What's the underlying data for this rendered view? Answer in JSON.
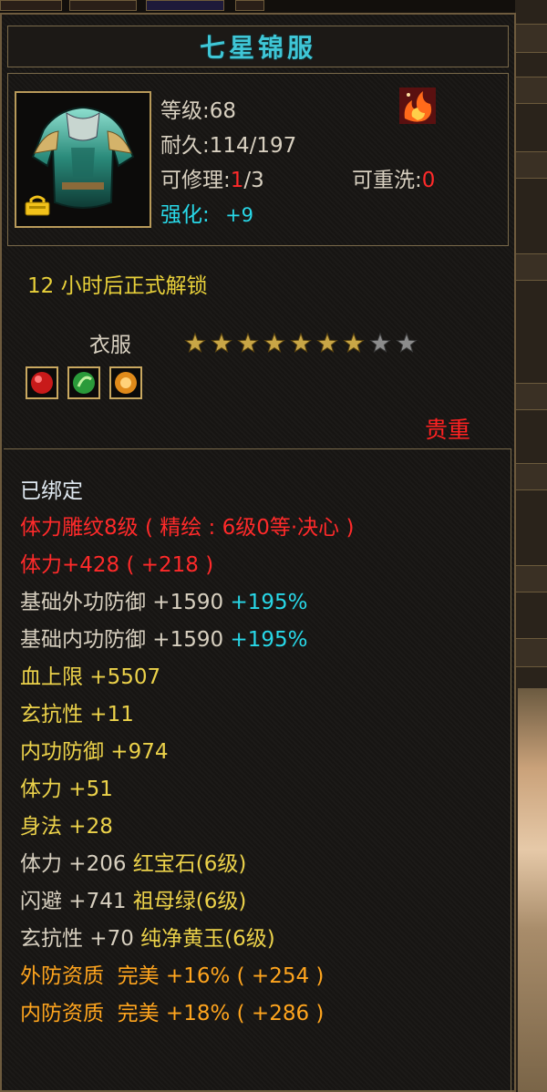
{
  "item": {
    "name": "七星锦服",
    "level": "等级:68",
    "durability": "耐久:114/197",
    "repair_label": "可修理:",
    "repair_value": "1",
    "repair_total": "/3",
    "rewash_label": "可重洗:",
    "rewash_value": "0",
    "enhance_label": "强化:",
    "enhance_value": "+9",
    "unlock_notice": "12 小时后正式解锁",
    "type": "衣服",
    "stars_filled": 7,
    "stars_total": 9,
    "rarity": "贵重",
    "icon": "armor-icon",
    "top_right_icon": "fire-emblem-icon",
    "gems": [
      "red-gem-icon",
      "green-gem-icon",
      "orange-gem-icon"
    ]
  },
  "attributes": [
    {
      "text": "已绑定",
      "color": "white-cyan"
    },
    {
      "text": "体力雕纹8级 ( 精绘 : 6级0等·决心 )",
      "color": "red"
    },
    {
      "text": "体力+428 ( +218 )",
      "color": "red"
    },
    {
      "text": "基础外功防御 +1590",
      "suffix": "+195%",
      "color": "white"
    },
    {
      "text": "基础内功防御 +1590",
      "suffix": "+195%",
      "color": "white"
    },
    {
      "text": "血上限 +5507",
      "color": "yellow"
    },
    {
      "text": "玄抗性 +11",
      "color": "yellow"
    },
    {
      "text": "内功防御 +974",
      "color": "yellow"
    },
    {
      "text": "体力 +51",
      "color": "yellow"
    },
    {
      "text": "身法 +28",
      "color": "yellow"
    },
    {
      "text": "体力 +206",
      "suffix": "红宝石(6级)",
      "color": "white"
    },
    {
      "text": "闪避 +741",
      "suffix": "祖母绿(6级)",
      "color": "white"
    },
    {
      "text": "玄抗性 +70",
      "suffix": "纯净黄玉(6级)",
      "color": "white"
    },
    {
      "text": "外防资质  完美 +16% ( +254 )",
      "color": "orange"
    },
    {
      "text": "内防资质  完美 +18% ( +286 )",
      "color": "orange"
    }
  ],
  "colors": {
    "title": "#3fc6d6",
    "red": "#ff2a2a",
    "yellow": "#ecd24a",
    "cyan": "#28d8e8",
    "orange": "#ffa51e",
    "border": "#6e5b3e"
  }
}
